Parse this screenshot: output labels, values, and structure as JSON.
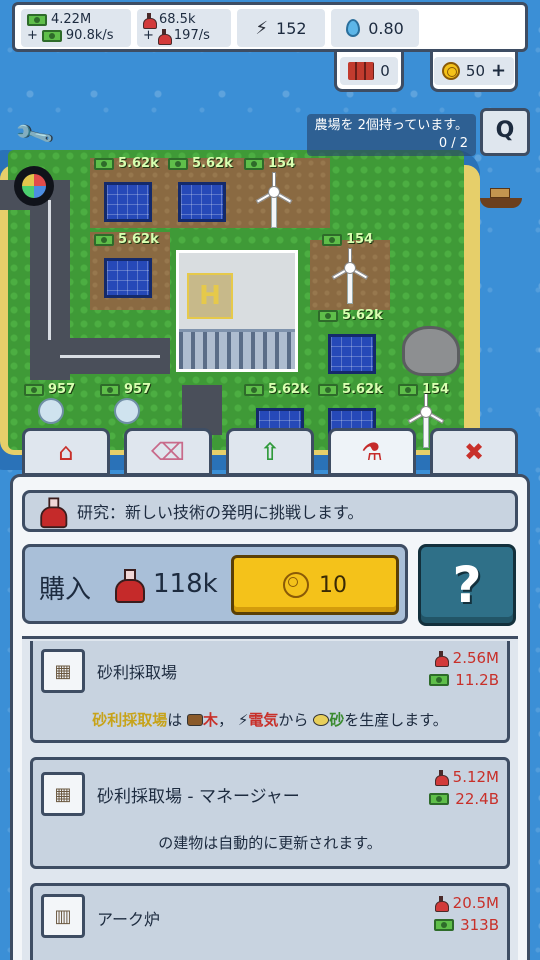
{
  "hud": {
    "cash": "4.22M",
    "cash_rate": "90.8k/s",
    "cash_rate_prefix": "+",
    "research": "68.5k",
    "research_rate": "197/s",
    "research_rate_prefix": "+",
    "energy": "152",
    "water": "0.80",
    "dynamite": "0",
    "coins": "50",
    "coins_add": "+"
  },
  "mission": {
    "text": "農場を 2個持っています。",
    "progress": "0 / 2",
    "q_label": "Q"
  },
  "map_labels": {
    "t1": "5.62k",
    "t2": "5.62k",
    "t3": "154",
    "t4": "5.62k",
    "t5": "154",
    "t6": "5.62k",
    "t7": "957",
    "t8": "957",
    "t9": "5.62k",
    "t10": "5.62k",
    "t11": "154"
  },
  "tabs": [
    {
      "name": "home-icon",
      "glyph": "⌂"
    },
    {
      "name": "eraser-icon",
      "glyph": "⌫"
    },
    {
      "name": "upgrade-arrow-icon",
      "glyph": "⇧"
    },
    {
      "name": "research-flask-icon",
      "glyph": "⚗"
    },
    {
      "name": "close-icon",
      "glyph": "✖"
    }
  ],
  "research_header": "研究：新しい技術の発明に挑戦します。",
  "buy": {
    "label": "購入",
    "cost": "118k",
    "coin_price": "10",
    "help": "?"
  },
  "items": [
    {
      "name": "砂利採取場",
      "cost_research": "2.56M",
      "cost_cash": "11.2B",
      "desc_parts": {
        "subject": "砂利採取場",
        "is": "は",
        "wood": "木",
        "comma": "，",
        "elec": "電気",
        "from": "から",
        "sand": "砂",
        "produce": "を生産します。"
      }
    },
    {
      "name": "砂利採取場 - マネージャー",
      "cost_research": "5.12M",
      "cost_cash": "22.4B",
      "desc": "の建物は自動的に更新されます。"
    },
    {
      "name": "アーク炉",
      "cost_research": "20.5M",
      "cost_cash": "313B"
    }
  ],
  "colors": {
    "panel_border": "#3e4d63",
    "accent_yellow": "#f4c21a",
    "cost_red": "#c8302a",
    "help_teal": "#2f7088"
  }
}
